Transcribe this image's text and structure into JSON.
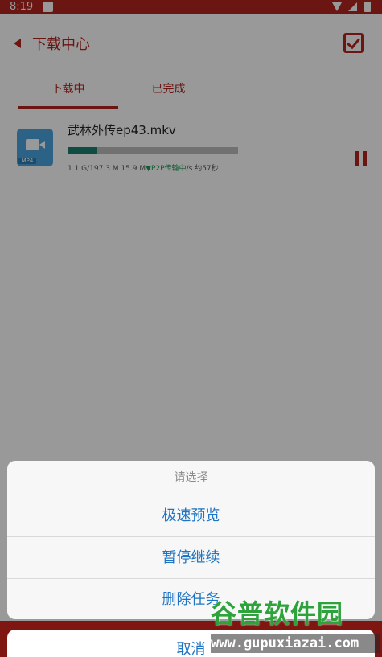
{
  "status_bar": {
    "time": "8:19"
  },
  "header": {
    "title": "下载中心"
  },
  "tabs": [
    {
      "label": "下载中",
      "active": true
    },
    {
      "label": "已完成",
      "active": false
    }
  ],
  "download_item": {
    "filename": "武林外传ep43.mkv",
    "file_ext": "MP4",
    "progress_fraction": 0.17,
    "size_text": "1.1 G/197.3 M 15.9 M",
    "p2p_text": "▼P2P传输中",
    "speed_eta_text": "/s 约57秒"
  },
  "action_sheet": {
    "title": "请选择",
    "options": [
      "极速预览",
      "暂停继续",
      "删除任务"
    ],
    "cancel": "取消"
  },
  "watermark": {
    "brand": "谷普软件园",
    "url": "www.gupuxiazai.com"
  },
  "colors": {
    "accent": "#b3261e",
    "link": "#1e74c4",
    "progress": "#1a7f6e"
  }
}
